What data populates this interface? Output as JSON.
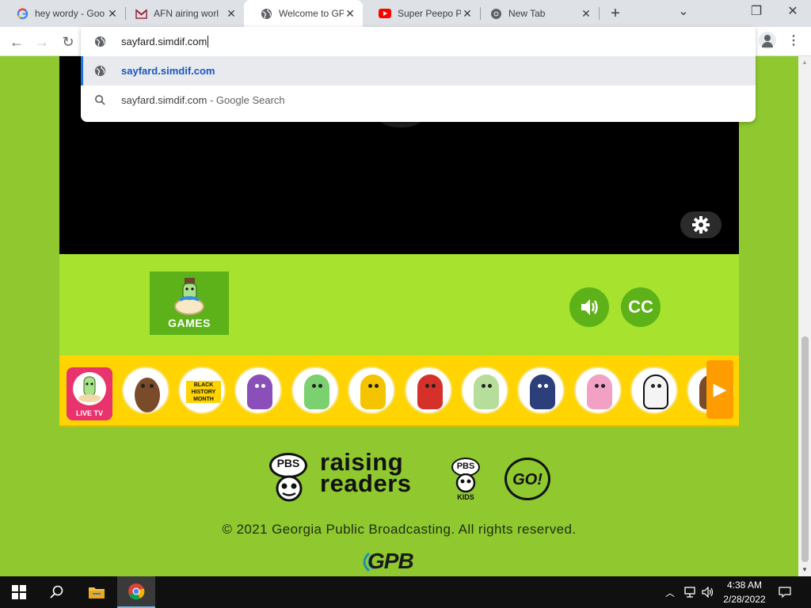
{
  "browser": {
    "tabs": [
      {
        "title": "hey wordy - Goo",
        "favicon": "google-g"
      },
      {
        "title": "AFN airing worl",
        "favicon": "gmail-m"
      },
      {
        "title": "Welcome to GP",
        "favicon": "globe",
        "active": true
      },
      {
        "title": "Super Peepo Ps",
        "favicon": "youtube-play"
      },
      {
        "title": "New Tab",
        "favicon": "chrome-logo"
      }
    ],
    "close_glyph": "✕",
    "new_tab_glyph": "+",
    "window_controls": {
      "minimize": "⌄",
      "restore": "❐",
      "close": "✕"
    },
    "nav": {
      "back": "←",
      "forward": "→",
      "reload": "↻"
    },
    "omnibox": {
      "value": "sayfard.simdif.com",
      "suggestions": [
        {
          "text": "sayfard.simdif.com",
          "icon": "globe-icon"
        },
        {
          "text": "sayfard.simdif.com",
          "suffix": " - Google Search",
          "icon": "search-icon"
        }
      ]
    },
    "menu_glyph": "⋮"
  },
  "page": {
    "games_label": "GAMES",
    "cc_label": "CC",
    "live_tv_label": "LIVE TV",
    "black_history_label": "BLACK HISTORY MONTH",
    "next_arrow": "▶",
    "raising_readers": "raising\nreaders",
    "pbs": "PBS",
    "kids": "KIDS",
    "go": "GO!",
    "copyright": "© 2021 Georgia Public Broadcasting. All rights reserved.",
    "gpb": "GPB",
    "colors": {
      "page_bg": "#8fc92f",
      "controls_bg": "#a6e22e",
      "strip_bg": "#ffd400",
      "button_green": "#5cb218"
    }
  },
  "taskbar": {
    "time": "4:38 AM",
    "date": "2/28/2022"
  }
}
